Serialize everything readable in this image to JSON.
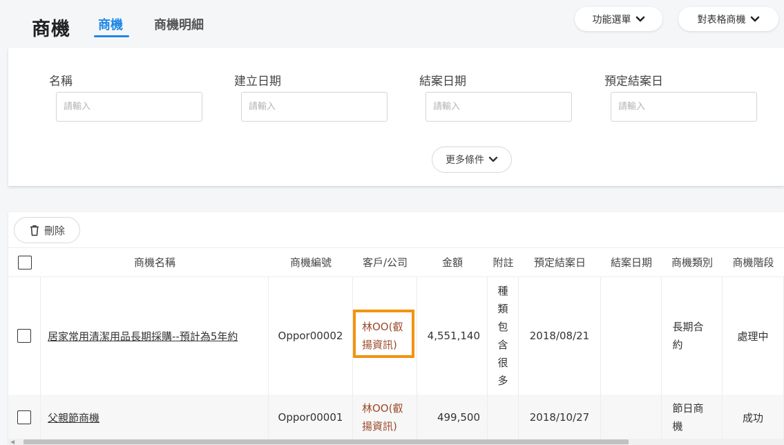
{
  "header": {
    "title": "商機",
    "tabs": [
      {
        "label": "商機"
      },
      {
        "label": "商機明細"
      }
    ],
    "function_menu": "功能選單",
    "table_menu": "對表格商機"
  },
  "filters": {
    "fields": [
      {
        "label": "名稱",
        "placeholder": "請輸入"
      },
      {
        "label": "建立日期",
        "placeholder": "請輸入"
      },
      {
        "label": "結案日期",
        "placeholder": "請輸入"
      },
      {
        "label": "預定結案日",
        "placeholder": "請輸入"
      }
    ],
    "more_label": "更多條件"
  },
  "table": {
    "delete_label": "刪除",
    "columns": [
      "商機名稱",
      "商機編號",
      "客戶/公司",
      "金額",
      "附註",
      "預定結案日",
      "結案日期",
      "商機類別",
      "商機階段"
    ],
    "rows": [
      {
        "name": "居家常用清潔用品長期採購--預計為5年約",
        "code": "Oppor00002",
        "customer": "林OO(叡揚資訊)",
        "amount": "4,551,140",
        "note": "種類包含很多",
        "due": "2018/08/21",
        "closed": "",
        "category": "長期合約",
        "stage": "處理中"
      },
      {
        "name": "父親節商機",
        "code": "Oppor00001",
        "customer": "林OO(叡揚資訊)",
        "amount": "499,500",
        "note": "",
        "due": "2018/10/27",
        "closed": "",
        "category": "節日商機",
        "stage": "成功"
      }
    ]
  },
  "colors": {
    "accent": "#1e88e5",
    "highlight": "#f2930f",
    "customer_text": "#9b4a2a"
  },
  "icons": [
    "chevron-down-icon",
    "trash-icon"
  ]
}
